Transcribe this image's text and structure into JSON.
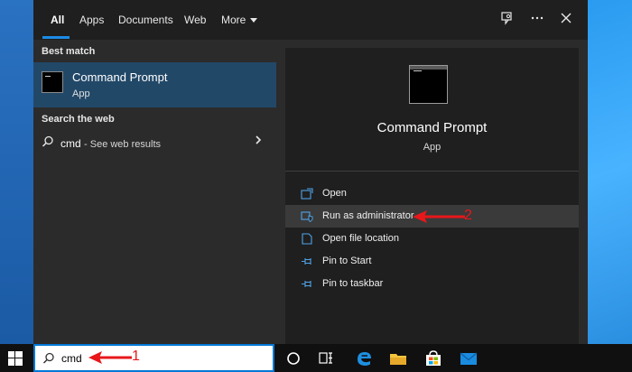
{
  "tabs": [
    "All",
    "Apps",
    "Documents",
    "Web",
    "More"
  ],
  "top_icons": [
    "feedback-icon",
    "more-options-icon",
    "close-icon"
  ],
  "left": {
    "best_match_title": "Best match",
    "best_match": {
      "title": "Command Prompt",
      "type": "App"
    },
    "search_web_title": "Search the web",
    "web_result": {
      "query": "cmd",
      "suffix": "- See web results"
    }
  },
  "detail": {
    "title": "Command Prompt",
    "type": "App",
    "actions": [
      {
        "label": "Open",
        "icon": "open-icon"
      },
      {
        "label": "Run as administrator",
        "icon": "shield-icon"
      },
      {
        "label": "Open file location",
        "icon": "file-location-icon"
      },
      {
        "label": "Pin to Start",
        "icon": "pin-icon"
      },
      {
        "label": "Pin to taskbar",
        "icon": "pin-icon"
      }
    ]
  },
  "taskbar": {
    "search_value": "cmd",
    "icons": [
      "start-icon",
      "cortana-icon",
      "task-view-icon",
      "edge-icon",
      "file-explorer-icon",
      "store-icon",
      "mail-icon"
    ]
  },
  "annotations": {
    "step1": "1",
    "step2": "2"
  },
  "colors": {
    "accent": "#0078d7",
    "selection": "#224868",
    "annotation": "#e8171a"
  }
}
